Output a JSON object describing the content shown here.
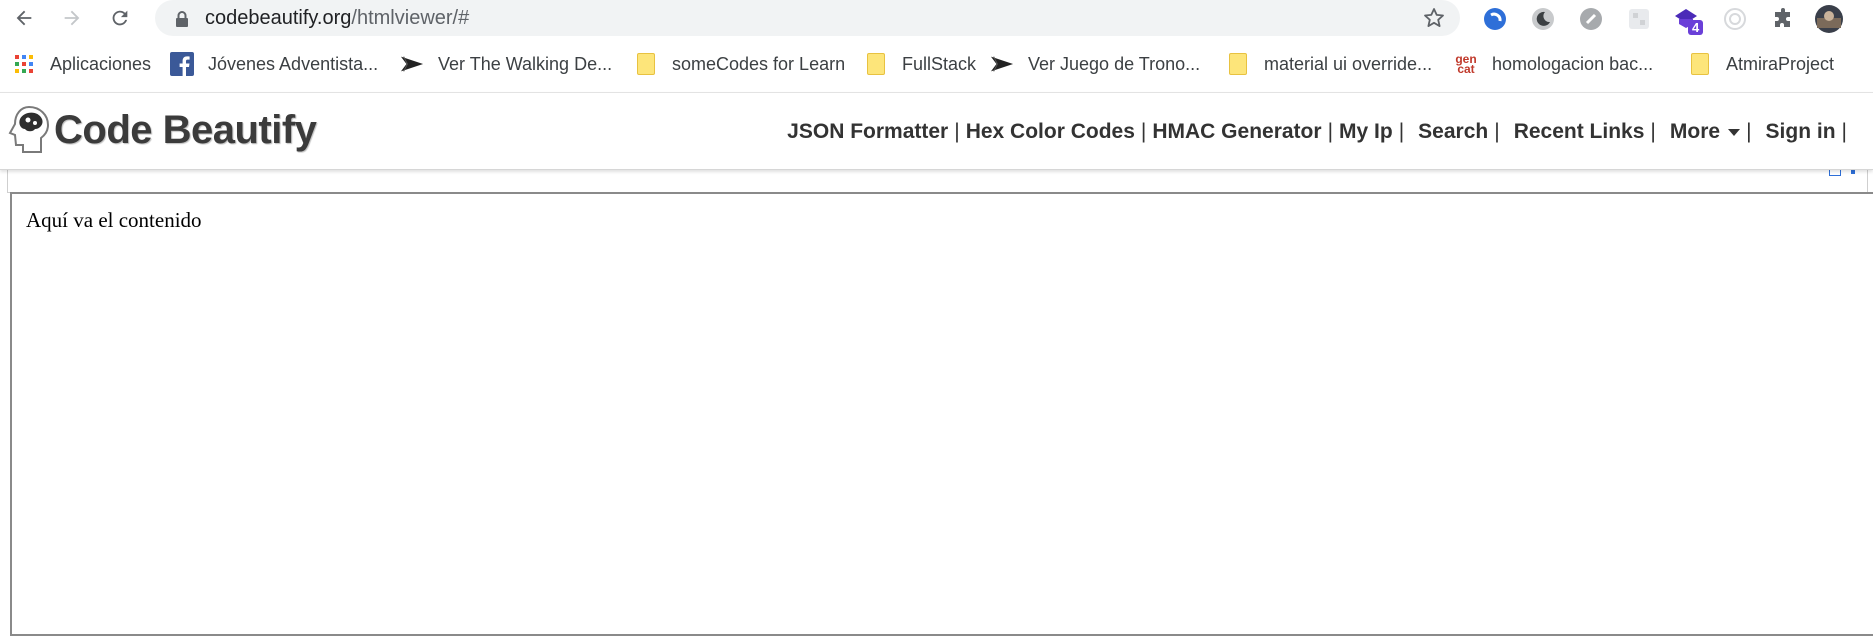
{
  "browser": {
    "url_host": "codebeautify.org",
    "url_path": "/htmlviewer/#",
    "extensions": [
      {
        "name": "extension-blue-icon"
      },
      {
        "name": "dark-mode-icon"
      },
      {
        "name": "link-icon"
      },
      {
        "name": "grid-extension-icon"
      },
      {
        "name": "extension-badge-icon",
        "badge": "4"
      },
      {
        "name": "target-icon"
      },
      {
        "name": "puzzle-icon"
      },
      {
        "name": "profile-avatar"
      }
    ]
  },
  "bookmarks": [
    {
      "label": "Aplicaciones",
      "icon": "apps-grid-icon"
    },
    {
      "label": "Jóvenes Adventista...",
      "icon": "facebook-icon"
    },
    {
      "label": "Ver The Walking De...",
      "icon": "site-icon"
    },
    {
      "label": "someCodes for Learn",
      "icon": "folder-icon"
    },
    {
      "label": "FullStack",
      "icon": "folder-icon"
    },
    {
      "label": "Ver Juego de Trono...",
      "icon": "site-icon"
    },
    {
      "label": "material ui override...",
      "icon": "folder-icon"
    },
    {
      "label": "homologacion bac...",
      "icon": "gencat-icon"
    },
    {
      "label": "AtmiraProject",
      "icon": "folder-icon"
    }
  ],
  "gencat_text": {
    "line1": "gen",
    "line2": "cat"
  },
  "site": {
    "logo_text": "Code Beautify",
    "menu": {
      "json_formatter": "JSON Formatter",
      "hex_color_codes": "Hex Color Codes",
      "hmac_generator": "HMAC Generator",
      "my_ip": "My Ip",
      "search": "Search",
      "recent_links": "Recent Links",
      "more": "More",
      "sign_in": "Sign in",
      "separator": "|"
    }
  },
  "viewer": {
    "content": "Aquí va el contenido"
  },
  "colors": {
    "omnibox_bg": "#f1f3f4",
    "folder": "#fde57a",
    "badge": "#6a3fd8",
    "facebook": "#3b5998"
  }
}
